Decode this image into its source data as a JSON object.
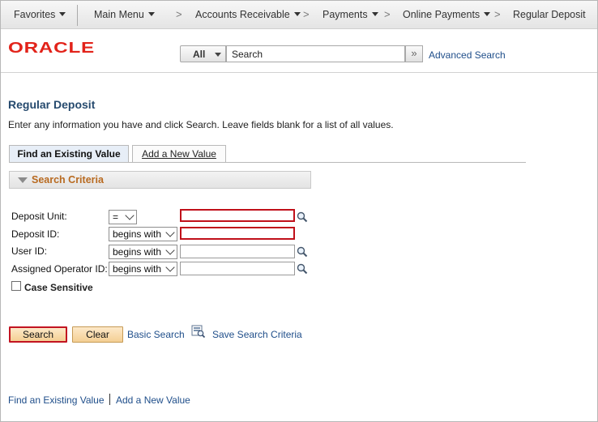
{
  "nav": {
    "favorites": "Favorites",
    "main_menu": "Main Menu",
    "crumbs": [
      "Accounts Receivable",
      "Payments",
      "Online Payments"
    ],
    "current": "Regular Deposit",
    "separator": ">"
  },
  "header": {
    "logo": "ORACLE",
    "search_scope": "All",
    "search_placeholder": "Search",
    "go_glyph": "»",
    "advanced_search": "Advanced Search"
  },
  "page": {
    "title": "Regular Deposit",
    "instructions": "Enter any information you have and click Search. Leave fields blank for a list of all values."
  },
  "tabs": [
    {
      "label": "Find an Existing Value",
      "active": true
    },
    {
      "label": "Add a New Value",
      "active": false
    }
  ],
  "criteria": {
    "heading": "Search Criteria",
    "fields": [
      {
        "label": "Deposit Unit:",
        "operator": "=",
        "value": "",
        "required": true,
        "lookup": true
      },
      {
        "label": "Deposit ID:",
        "operator": "begins with",
        "value": "",
        "required": true,
        "lookup": false
      },
      {
        "label": "User ID:",
        "operator": "begins with",
        "value": "",
        "required": false,
        "lookup": true
      },
      {
        "label": "Assigned Operator ID:",
        "operator": "begins with",
        "value": "",
        "required": false,
        "lookup": true
      }
    ],
    "case_sensitive": {
      "label": "Case Sensitive",
      "checked": false
    }
  },
  "actions": {
    "search": "Search",
    "clear": "Clear",
    "basic_search": "Basic Search",
    "save_criteria": "Save Search Criteria"
  },
  "footer": {
    "find_existing": "Find an Existing Value",
    "add_new": "Add a New Value"
  },
  "colors": {
    "oracle_red": "#e2231a",
    "link_blue": "#1f4e8a",
    "title_blue": "#264a6e",
    "required_red": "#c0101a",
    "criteria_orange": "#b86a20"
  }
}
